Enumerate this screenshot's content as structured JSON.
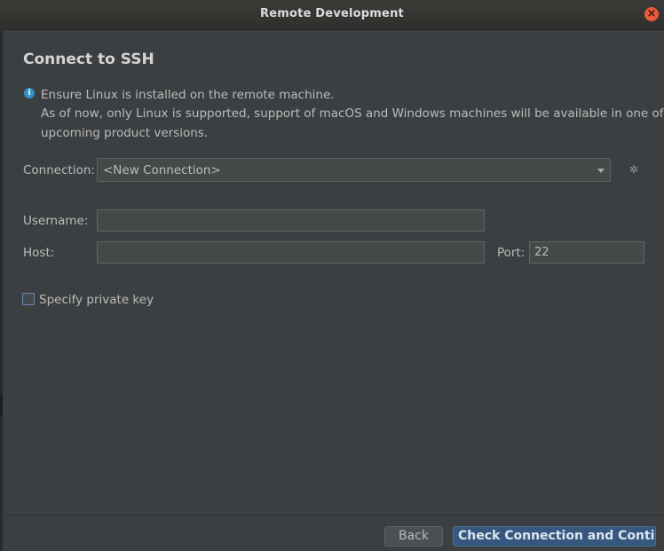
{
  "window": {
    "title": "Remote Development",
    "close_glyph": "×"
  },
  "page": {
    "heading": "Connect to SSH"
  },
  "info": {
    "icon": "info-icon",
    "lines": [
      "Ensure Linux is installed on the remote machine.",
      "As of now, only Linux is supported, support of macOS and Windows machines will be available in one of the",
      "upcoming product versions."
    ]
  },
  "connection": {
    "label": "Connection:",
    "selected": "<New Connection>",
    "settings_icon": "gear-icon"
  },
  "form": {
    "username_label": "Username:",
    "username_value": "",
    "host_label": "Host:",
    "host_value": "",
    "port_label": "Port:",
    "port_value": "22"
  },
  "private_key": {
    "label": "Specify private key",
    "checked": false
  },
  "footer": {
    "back_label": "Back",
    "primary_label": "Check Connection and Continue"
  },
  "colors": {
    "accent": "#365880",
    "background": "#3c3f41",
    "info": "#3592c4",
    "close": "#e9593b"
  }
}
